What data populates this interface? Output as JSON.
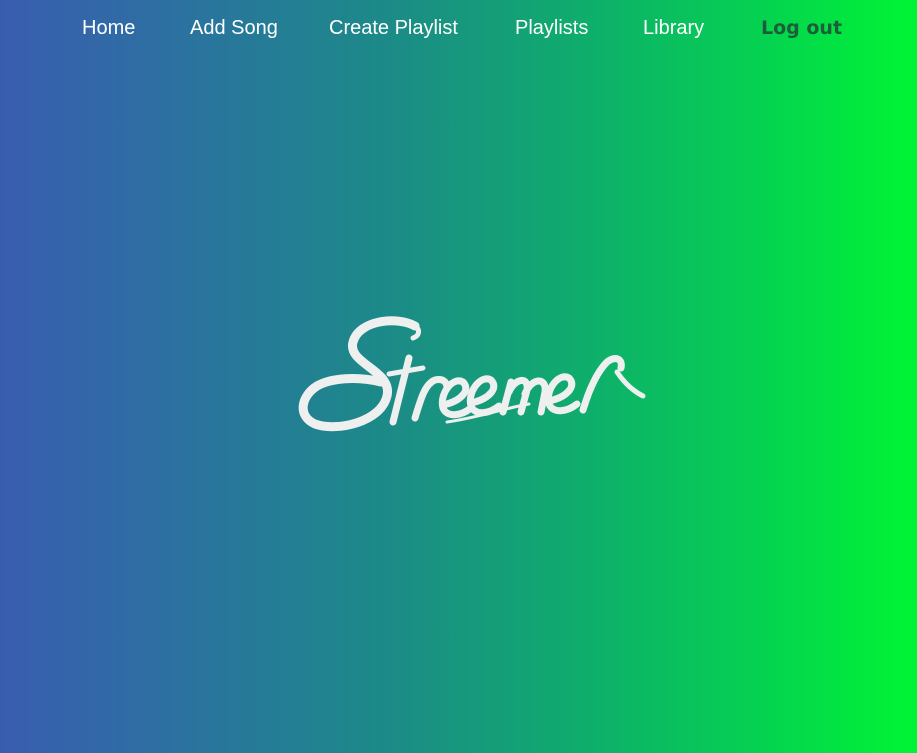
{
  "nav": {
    "items": [
      {
        "label": "Home"
      },
      {
        "label": "Add Song"
      },
      {
        "label": "Create Playlist"
      },
      {
        "label": "Playlists"
      },
      {
        "label": "Library"
      },
      {
        "label": "Log out"
      }
    ]
  },
  "logo": {
    "text": "Streemer"
  },
  "colors": {
    "gradient_start": "#3a5cb0",
    "gradient_end": "#00f534",
    "nav_text": "#ffffff",
    "logout_text": "#1c5e3a",
    "logo_text": "#f0f0f0"
  }
}
